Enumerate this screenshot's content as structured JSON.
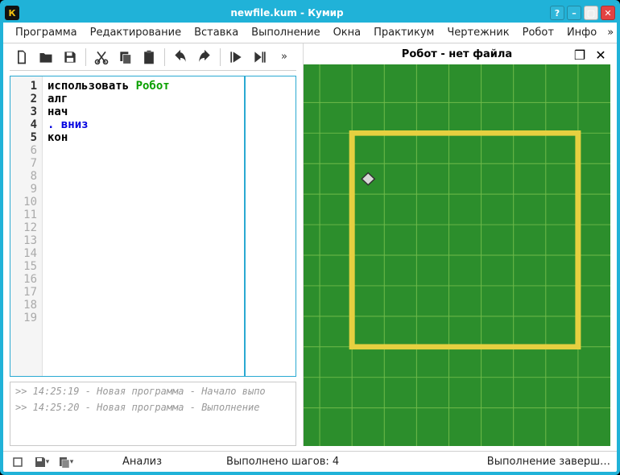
{
  "window": {
    "title": "newfile.kum - Кумир",
    "app_icon_letter": "К"
  },
  "menu": {
    "items": [
      "Программа",
      "Редактирование",
      "Вставка",
      "Выполнение",
      "Окна",
      "Практикум",
      "Чертежник",
      "Робот",
      "Инфо"
    ],
    "overflow": "»"
  },
  "toolbar": {
    "overflow": "»"
  },
  "editor": {
    "lines_shown": 19,
    "active_lines": 5,
    "code": [
      {
        "segments": [
          {
            "t": "использовать ",
            "c": ""
          },
          {
            "t": "Робот",
            "c": "tok-green"
          }
        ]
      },
      {
        "segments": [
          {
            "t": "алг",
            "c": ""
          }
        ]
      },
      {
        "segments": [
          {
            "t": "нач",
            "c": ""
          }
        ]
      },
      {
        "segments": [
          {
            "t": ". вниз",
            "c": "tok-blue"
          }
        ]
      },
      {
        "segments": [
          {
            "t": "кон",
            "c": ""
          }
        ]
      }
    ]
  },
  "console": {
    "entries": [
      ">> 14:25:19 - Новая программа - Начало выпо",
      ">> 14:25:20 - Новая программа - Выполнение"
    ]
  },
  "robot_panel": {
    "title": "Робот - нет файла"
  },
  "status": {
    "analysis": "Анализ",
    "steps": "Выполнено шагов: 4",
    "state": "Выполнение заверш…"
  }
}
